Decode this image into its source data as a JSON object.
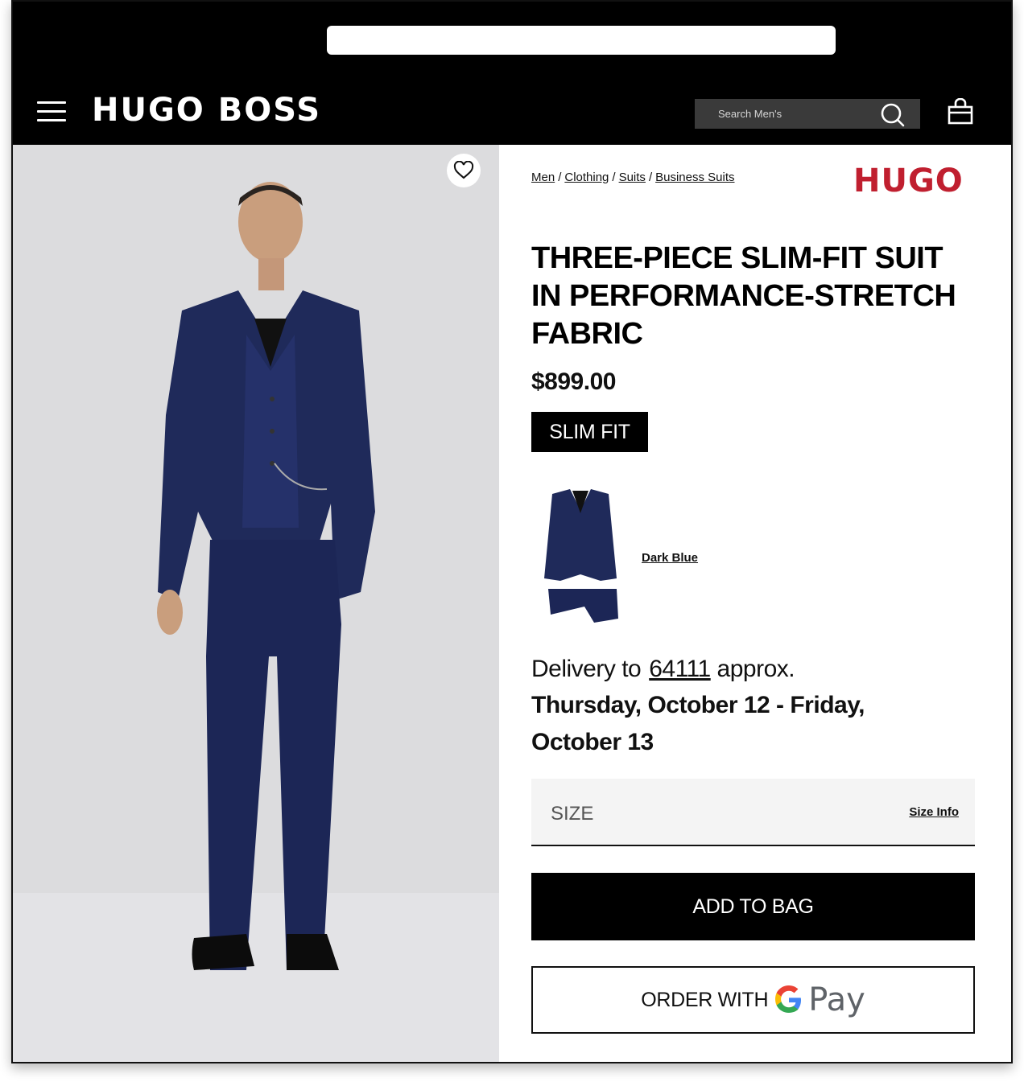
{
  "header": {
    "brand": "HUGO BOSS",
    "search_placeholder": "Search Men's"
  },
  "breadcrumb": [
    "Men",
    "Clothing",
    "Suits",
    "Business Suits"
  ],
  "sub_brand": "HUGO",
  "product": {
    "title": "THREE-PIECE SLIM-FIT SUIT IN PERFORMANCE-STRETCH FABRIC",
    "price": "$899.00",
    "fit": "SLIM FIT",
    "color_name": "Dark Blue"
  },
  "delivery": {
    "prefix": "Delivery to",
    "zip": "64111",
    "suffix": "approx.",
    "dates": "Thursday, October 12 - Friday, October 13"
  },
  "size": {
    "label": "SIZE",
    "info_link": "Size Info"
  },
  "actions": {
    "add_to_bag": "ADD TO BAG",
    "order_with": "ORDER WITH",
    "pay_word": "Pay"
  },
  "colors": {
    "header_bg": "#000000",
    "brand_red": "#c01f2f",
    "suit_navy": "#1f2a5a"
  }
}
